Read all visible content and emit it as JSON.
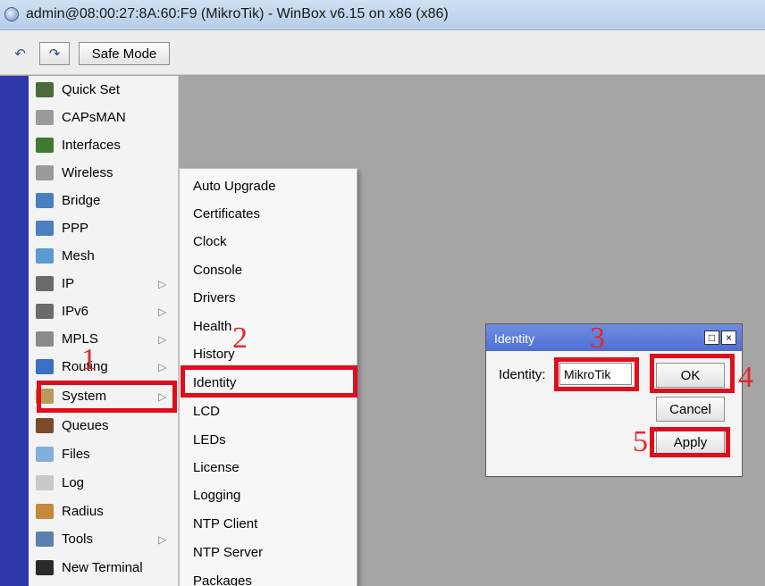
{
  "window": {
    "title": "admin@08:00:27:8A:60:F9 (MikroTik) - WinBox v6.15 on x86 (x86)"
  },
  "toolbar": {
    "undo_icon": "↶",
    "redo_icon": "↷",
    "safe_mode_label": "Safe Mode"
  },
  "menu": {
    "items": [
      {
        "label": "Quick Set",
        "icon": "quick-set-icon",
        "color": "#4a6a3a",
        "submenu": false
      },
      {
        "label": "CAPsMAN",
        "icon": "antenna-icon",
        "color": "#9a9a9a",
        "submenu": false
      },
      {
        "label": "Interfaces",
        "icon": "interfaces-icon",
        "color": "#3f7a2e",
        "submenu": false
      },
      {
        "label": "Wireless",
        "icon": "antenna-icon",
        "color": "#9a9a9a",
        "submenu": false
      },
      {
        "label": "Bridge",
        "icon": "bridge-icon",
        "color": "#4a7fc1",
        "submenu": false
      },
      {
        "label": "PPP",
        "icon": "ppp-icon",
        "color": "#4a7fc1",
        "submenu": false
      },
      {
        "label": "Mesh",
        "icon": "mesh-icon",
        "color": "#5a9ad0",
        "submenu": false
      },
      {
        "label": "IP",
        "icon": "ip-icon",
        "color": "#6b6b6b",
        "submenu": true
      },
      {
        "label": "IPv6",
        "icon": "ipv6-icon",
        "color": "#6b6b6b",
        "submenu": true
      },
      {
        "label": "MPLS",
        "icon": "mpls-icon",
        "color": "#8a8a8a",
        "submenu": true
      },
      {
        "label": "Routing",
        "icon": "routing-icon",
        "color": "#3a6fc4",
        "submenu": true
      },
      {
        "label": "System",
        "icon": "gear-icon",
        "color": "#b89a5a",
        "submenu": true
      },
      {
        "label": "Queues",
        "icon": "queues-icon",
        "color": "#7a4a2a",
        "submenu": false
      },
      {
        "label": "Files",
        "icon": "folder-icon",
        "color": "#7fb0de",
        "submenu": false
      },
      {
        "label": "Log",
        "icon": "log-icon",
        "color": "#c9c9c9",
        "submenu": false
      },
      {
        "label": "Radius",
        "icon": "radius-icon",
        "color": "#c28a3a",
        "submenu": false
      },
      {
        "label": "Tools",
        "icon": "tools-icon",
        "color": "#5a7fb0",
        "submenu": true
      },
      {
        "label": "New Terminal",
        "icon": "terminal-icon",
        "color": "#2a2a2a",
        "submenu": false
      }
    ],
    "submenu_arrow": "▷"
  },
  "system_submenu": {
    "items": [
      "Auto Upgrade",
      "Certificates",
      "Clock",
      "Console",
      "Drivers",
      "Health",
      "History",
      "Identity",
      "LCD",
      "LEDs",
      "License",
      "Logging",
      "NTP Client",
      "NTP Server",
      "Packages"
    ]
  },
  "identity_dialog": {
    "title": "Identity",
    "restore_icon": "□",
    "close_icon": "×",
    "field_label": "Identity:",
    "field_value": "MikroTik",
    "ok_label": "OK",
    "cancel_label": "Cancel",
    "apply_label": "Apply"
  },
  "annotations": {
    "step1": "1",
    "step2": "2",
    "step3": "3",
    "step4": "4",
    "step5": "5",
    "highlight_color": "#e00d1b"
  }
}
